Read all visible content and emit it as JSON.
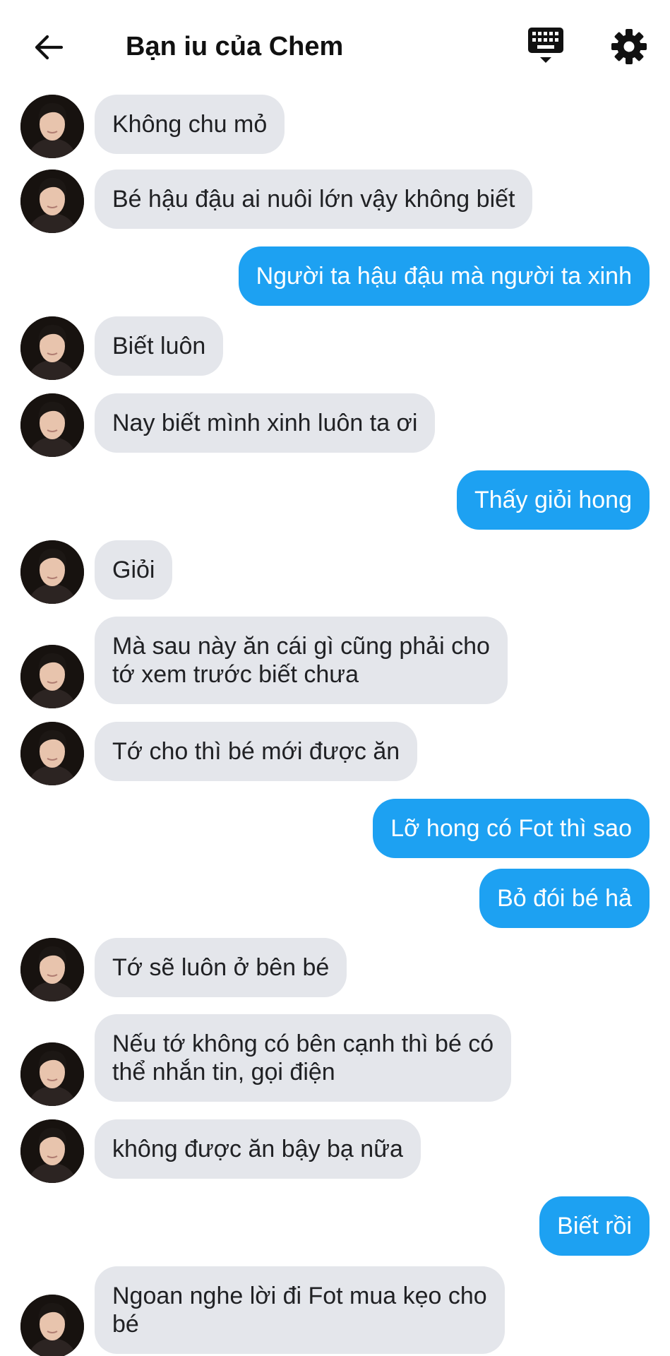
{
  "header": {
    "title": "Bạn iu của Chem",
    "back_icon": "arrow-left-icon",
    "keyboard_icon": "keyboard-icon",
    "settings_icon": "gear-icon"
  },
  "colors": {
    "incoming_bubble": "#e4e6eb",
    "outgoing_bubble": "#1da1f2",
    "outgoing_text": "#ffffff",
    "incoming_text": "#202124"
  },
  "messages": [
    {
      "side": "incoming",
      "text": "Không chu mỏ"
    },
    {
      "side": "incoming",
      "text": "Bé hậu đậu ai nuôi lớn vậy không biết"
    },
    {
      "side": "outgoing",
      "text": "Người ta hậu đậu mà người ta xinh"
    },
    {
      "side": "incoming",
      "text": "Biết luôn"
    },
    {
      "side": "incoming",
      "text": "Nay biết mình xinh luôn ta ơi"
    },
    {
      "side": "outgoing",
      "text": "Thấy giỏi hong"
    },
    {
      "side": "incoming",
      "text": "Giỏi"
    },
    {
      "side": "incoming",
      "text": "Mà sau này ăn cái gì cũng phải cho\ntớ xem trước biết chưa"
    },
    {
      "side": "incoming",
      "text": "Tớ cho thì bé mới được ăn"
    },
    {
      "side": "outgoing",
      "text": "Lỡ hong có Fot thì sao"
    },
    {
      "side": "outgoing",
      "text": "Bỏ đói bé hả"
    },
    {
      "side": "incoming",
      "text": "Tớ sẽ luôn ở bên bé"
    },
    {
      "side": "incoming",
      "text": "Nếu tớ không có bên cạnh thì bé có\nthể nhắn tin, gọi điện"
    },
    {
      "side": "incoming",
      "text": "không được ăn bậy bạ nữa"
    },
    {
      "side": "outgoing",
      "text": "Biết rồi"
    },
    {
      "side": "incoming",
      "text": "Ngoan nghe lời đi Fot mua kẹo cho\nbé"
    }
  ]
}
